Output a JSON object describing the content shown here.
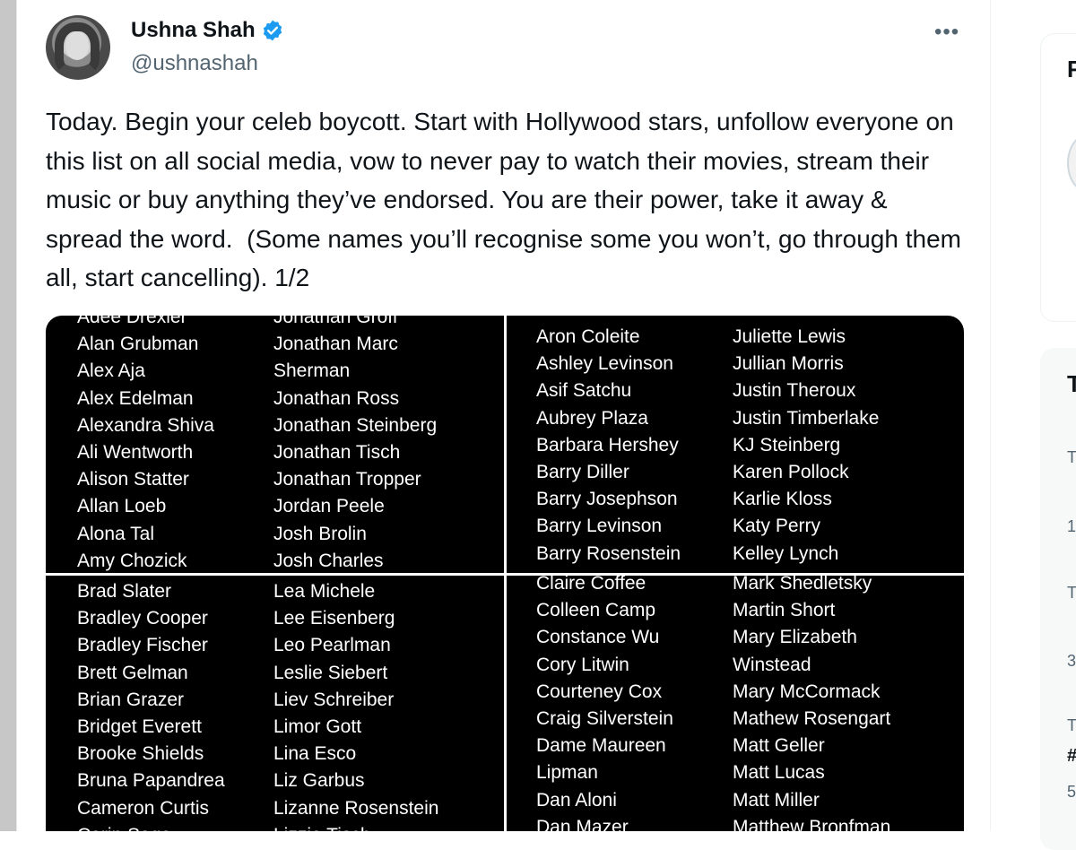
{
  "tweet": {
    "author": {
      "display_name": "Ushna Shah",
      "handle": "@ushnashah",
      "verified": true
    },
    "more_icon": "•••",
    "text": "Today. Begin your celeb boycott. Start with Hollywood stars, unfollow everyone on this list on all social media, vow to never pay to watch their movies, stream their music or buy anything they’ve endorsed. You are their power, take it away & spread the word.  (Some names you’ll recognise some you won’t, go through them all, start cancelling). 1/2",
    "media": {
      "panels": [
        {
          "col_a": [
            "Adee Drexler",
            "Alan Grubman",
            "Alex Aja",
            "Alex Edelman",
            "Alexandra Shiva",
            "Ali Wentworth",
            "Alison Statter",
            "Allan Loeb",
            "Alona Tal",
            "Amy Chozick"
          ],
          "col_b": [
            "Jonathan Groff",
            "Jonathan Marc",
            "Sherman",
            "Jonathan Ross",
            "Jonathan Steinberg",
            "Jonathan Tisch",
            "Jonathan Tropper",
            "Jordan Peele",
            "Josh Brolin",
            "Josh Charles"
          ]
        },
        {
          "col_a": [
            "Aron Coleite",
            "Ashley Levinson",
            "Asif Satchu",
            "Aubrey Plaza",
            "Barbara Hershey",
            "Barry Diller",
            "Barry Josephson",
            "Barry Levinson",
            "Barry Rosenstein"
          ],
          "col_b": [
            "Juliette Lewis",
            "Jullian Morris",
            "Justin Theroux",
            "Justin Timberlake",
            "KJ Steinberg",
            "Karen Pollock",
            "Karlie Kloss",
            "Katy Perry",
            "Kelley Lynch"
          ]
        },
        {
          "col_a": [
            "Brad Slater",
            "Bradley Cooper",
            "Bradley Fischer",
            "Brett Gelman",
            "Brian Grazer",
            "Bridget Everett",
            "Brooke Shields",
            "Bruna Papandrea",
            "Cameron Curtis",
            "Carin Sage"
          ],
          "col_b": [
            "Lea Michele",
            "Lee Eisenberg",
            "Leo Pearlman",
            "Leslie Siebert",
            "Liev Schreiber",
            "Limor Gott",
            "Lina Esco",
            "Liz Garbus",
            "Lizanne Rosenstein",
            "Lizzie Tisch"
          ]
        },
        {
          "col_a": [
            "Claire Coffee",
            "Colleen Camp",
            "Constance Wu",
            "Cory Litwin",
            "Courteney Cox",
            "Craig Silverstein",
            "Dame Maureen",
            "Lipman",
            "Dan Aloni",
            "Dan Mazer"
          ],
          "col_b": [
            "Mark Shedletsky",
            "Martin Short",
            "Mary Elizabeth",
            "Winstead",
            "Mary McCormack",
            "Mathew Rosengart",
            "Matt Geller",
            "Matt Lucas",
            "Matt Miller",
            "Matthew Bronfman"
          ]
        }
      ]
    }
  },
  "sidebar": {
    "card1_heading": "F",
    "card2_heading": "T",
    "card2_items": [
      "T",
      "1",
      "T",
      "3",
      "T",
      "#",
      "5"
    ]
  },
  "colors": {
    "text_primary": "#0f1419",
    "text_secondary": "#536471",
    "verified_blue": "#1d9bf0",
    "media_background": "#000000"
  }
}
